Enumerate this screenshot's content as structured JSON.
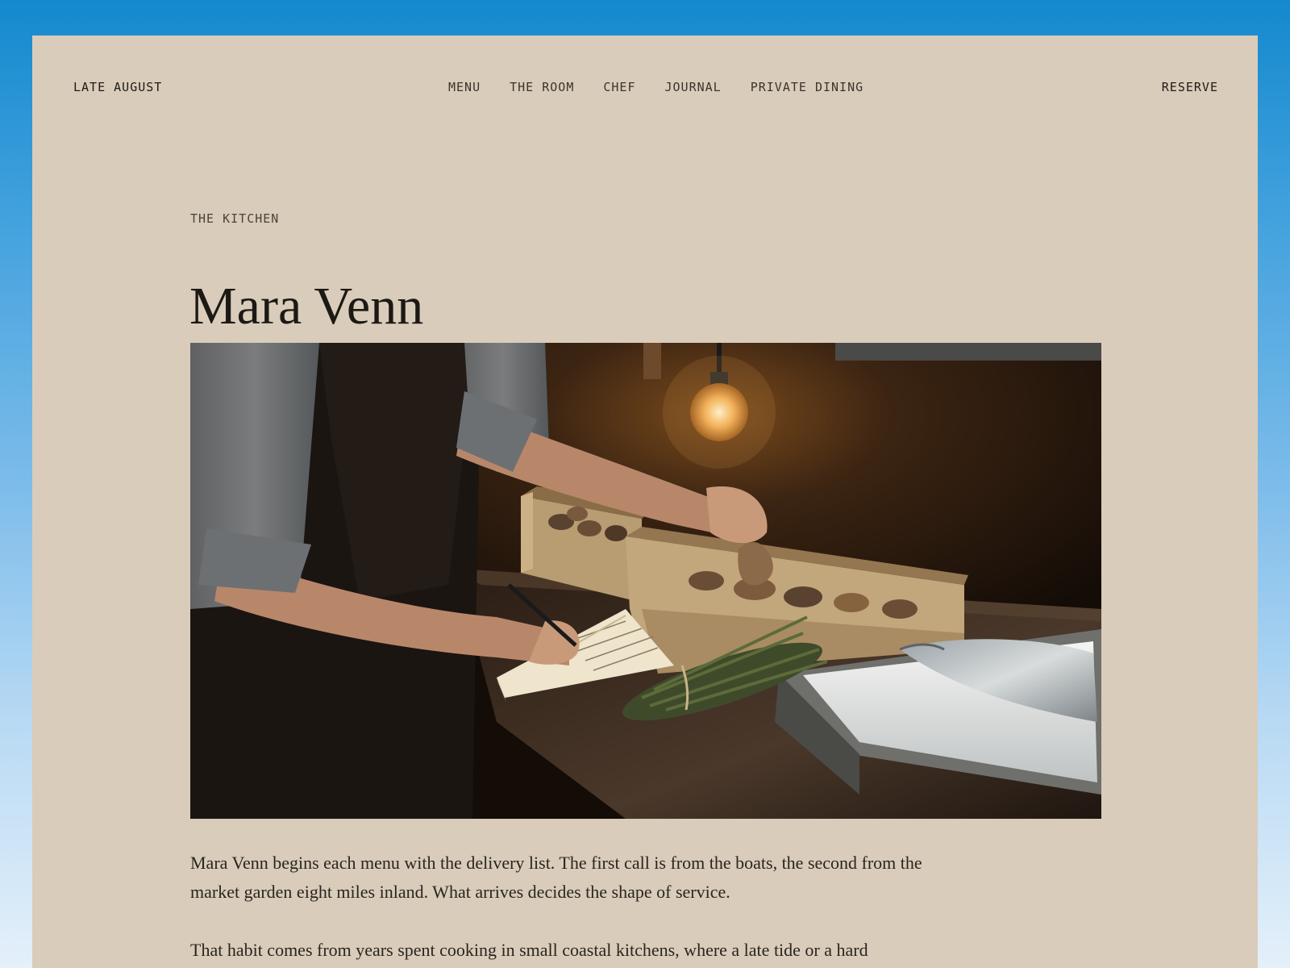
{
  "header": {
    "brand": "LATE AUGUST",
    "nav": [
      "MENU",
      "THE ROOM",
      "CHEF",
      "JOURNAL",
      "PRIVATE DINING"
    ],
    "cta": "RESERVE"
  },
  "article": {
    "eyebrow": "THE KITCHEN",
    "title": "Mara Venn",
    "hero_image": "chef-writing-notes-at-kitchen-counter",
    "paragraphs": [
      "Mara Venn begins each menu with the delivery list. The first call is from the boats, the second from the market garden eight miles inland. What arrives decides the shape of service.",
      "That habit comes from years spent cooking in small coastal kitchens, where a late tide or a hard"
    ]
  },
  "colors": {
    "page_background": "#d9ccba",
    "sky_top": "#1489cd",
    "sky_bottom": "#e4f0fa",
    "text": "#2a251f"
  }
}
